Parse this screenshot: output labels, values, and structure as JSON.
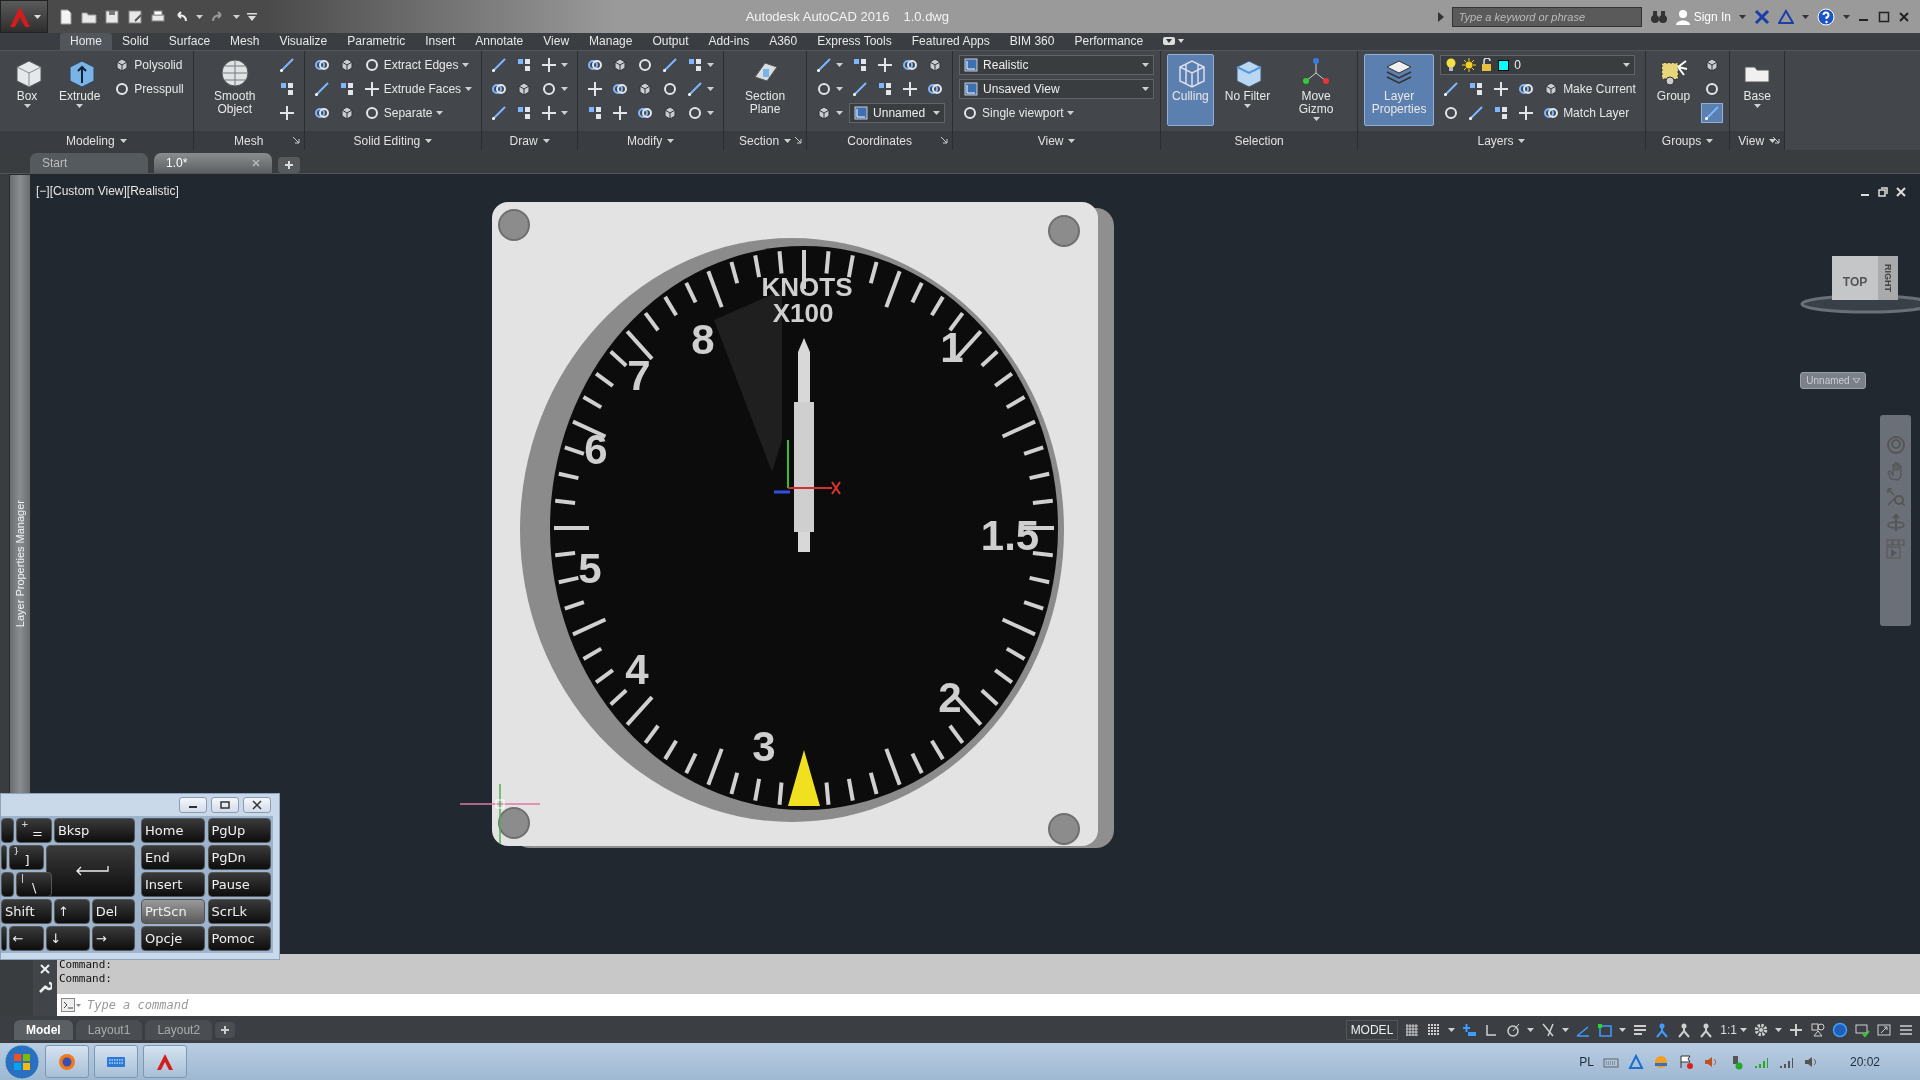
{
  "title_bar": {
    "title": "Autodesk AutoCAD 2016",
    "file": "1.0.dwg",
    "search": {
      "placeholder": "Type a keyword or phrase"
    },
    "sign_in": "Sign In"
  },
  "ribbon_tabs": [
    {
      "label": "Home",
      "selected": true
    },
    {
      "label": "Solid",
      "selected": false
    },
    {
      "label": "Surface",
      "selected": false
    },
    {
      "label": "Mesh",
      "selected": false
    },
    {
      "label": "Visualize",
      "selected": false
    },
    {
      "label": "Parametric",
      "selected": false
    },
    {
      "label": "Insert",
      "selected": false
    },
    {
      "label": "Annotate",
      "selected": false
    },
    {
      "label": "View",
      "selected": false
    },
    {
      "label": "Manage",
      "selected": false
    },
    {
      "label": "Output",
      "selected": false
    },
    {
      "label": "Add-ins",
      "selected": false
    },
    {
      "label": "A360",
      "selected": false
    },
    {
      "label": "Express Tools",
      "selected": false
    },
    {
      "label": "Featured Apps",
      "selected": false
    },
    {
      "label": "BIM 360",
      "selected": false
    },
    {
      "label": "Performance",
      "selected": false
    }
  ],
  "ribbon_panels": [
    {
      "title": "Modeling",
      "menu": true,
      "blocks": [
        {
          "kind": "large",
          "label": "Box",
          "dropdown": true,
          "on": false
        },
        {
          "kind": "large",
          "label": "Extrude",
          "dropdown": true,
          "on": false
        },
        {
          "kind": "stack",
          "rows": [
            [
              {
                "kind": "tool",
                "label": "Polysolid",
                "on": false
              }
            ],
            [
              {
                "kind": "tool",
                "label": "Presspull",
                "on": false
              }
            ]
          ]
        }
      ]
    },
    {
      "title": "Mesh",
      "launcher": true,
      "blocks": [
        {
          "kind": "large",
          "label": "Smooth Object",
          "on": false
        },
        {
          "kind": "stack",
          "rows": [
            [
              {
                "kind": "tool",
                "on": false
              }
            ],
            [
              {
                "kind": "tool",
                "on": false
              }
            ],
            [
              {
                "kind": "tool",
                "on": false
              }
            ]
          ]
        }
      ]
    },
    {
      "title": "Solid Editing",
      "menu": true,
      "blocks": [
        {
          "kind": "stack",
          "rows": [
            [
              {
                "kind": "tool",
                "on": false
              },
              {
                "kind": "tool",
                "on": false
              },
              {
                "kind": "tool",
                "label": "Extract Edges",
                "dropdown": true,
                "on": false
              }
            ],
            [
              {
                "kind": "tool",
                "on": false
              },
              {
                "kind": "tool",
                "on": false
              },
              {
                "kind": "tool",
                "label": "Extrude Faces",
                "dropdown": true,
                "on": false
              }
            ],
            [
              {
                "kind": "tool",
                "on": false
              },
              {
                "kind": "tool",
                "on": false
              },
              {
                "kind": "tool",
                "label": "Separate",
                "dropdown": true,
                "on": false
              }
            ]
          ]
        }
      ]
    },
    {
      "title": "Draw",
      "menu": true,
      "blocks": [
        {
          "kind": "stack",
          "rows": [
            [
              {
                "kind": "tool",
                "on": false
              },
              {
                "kind": "tool",
                "on": false
              },
              {
                "kind": "tool",
                "dropdown": true,
                "on": false
              }
            ],
            [
              {
                "kind": "tool",
                "on": false
              },
              {
                "kind": "tool",
                "on": false
              },
              {
                "kind": "tool",
                "dropdown": true,
                "on": false
              }
            ],
            [
              {
                "kind": "tool",
                "on": false
              },
              {
                "kind": "tool",
                "on": false
              },
              {
                "kind": "tool",
                "dropdown": true,
                "on": false
              }
            ]
          ]
        }
      ]
    },
    {
      "title": "Modify",
      "menu": true,
      "blocks": [
        {
          "kind": "stack",
          "rows": [
            [
              {
                "kind": "tool",
                "on": false
              },
              {
                "kind": "tool",
                "on": false
              },
              {
                "kind": "tool",
                "on": false
              },
              {
                "kind": "tool",
                "on": false
              },
              {
                "kind": "tool",
                "dropdown": true,
                "on": false
              }
            ],
            [
              {
                "kind": "tool",
                "on": false
              },
              {
                "kind": "tool",
                "on": false
              },
              {
                "kind": "tool",
                "on": false
              },
              {
                "kind": "tool",
                "on": false
              },
              {
                "kind": "tool",
                "dropdown": true,
                "on": false
              }
            ],
            [
              {
                "kind": "tool",
                "on": false
              },
              {
                "kind": "tool",
                "on": false
              },
              {
                "kind": "tool",
                "on": false
              },
              {
                "kind": "tool",
                "on": false
              },
              {
                "kind": "tool",
                "dropdown": true,
                "on": false
              }
            ]
          ]
        }
      ]
    },
    {
      "title": "Section",
      "menu": true,
      "launcher": true,
      "blocks": [
        {
          "kind": "large",
          "label": "Section Plane",
          "on": false
        }
      ]
    },
    {
      "title": "Coordinates",
      "launcher": true,
      "blocks": [
        {
          "kind": "stack",
          "rows": [
            [
              {
                "kind": "tool",
                "dropdown": true,
                "on": false
              },
              {
                "kind": "tool",
                "on": false
              },
              {
                "kind": "tool",
                "on": false
              },
              {
                "kind": "tool",
                "on": false
              },
              {
                "kind": "tool",
                "on": false
              }
            ],
            [
              {
                "kind": "tool",
                "dropdown": true,
                "on": false
              },
              {
                "kind": "tool",
                "on": false
              },
              {
                "kind": "tool",
                "on": false
              },
              {
                "kind": "tool",
                "on": false
              },
              {
                "kind": "tool",
                "on": false
              }
            ],
            [
              {
                "kind": "tool",
                "dropdown": true,
                "on": false
              },
              {
                "kind": "combo",
                "value": "Unnamed"
              }
            ]
          ]
        }
      ]
    },
    {
      "title": "View",
      "menu": true,
      "blocks": [
        {
          "kind": "stack",
          "rows": [
            [
              {
                "kind": "combo",
                "value": "Realistic"
              }
            ],
            [
              {
                "kind": "combo",
                "value": "Unsaved View"
              }
            ],
            [
              {
                "kind": "tool",
                "label": "Single viewport",
                "dropdown": true,
                "on": false
              }
            ]
          ]
        }
      ]
    },
    {
      "title": "Selection",
      "blocks": [
        {
          "kind": "large",
          "label": "Culling",
          "on": true
        },
        {
          "kind": "large",
          "label": "No Filter",
          "dropdown": true,
          "on": false
        },
        {
          "kind": "large",
          "label": "Move Gizmo",
          "dropdown": true,
          "on": false
        }
      ]
    },
    {
      "title": "Layers",
      "menu": true,
      "blocks": [
        {
          "kind": "large",
          "label": "Layer Properties",
          "on": true
        },
        {
          "kind": "stack",
          "rows": [
            [
              {
                "kind": "layer",
                "value": "0",
                "color": "#00ffff"
              }
            ],
            [
              {
                "kind": "tool",
                "on": false
              },
              {
                "kind": "tool",
                "on": false
              },
              {
                "kind": "tool",
                "on": false
              },
              {
                "kind": "tool",
                "on": false
              },
              {
                "kind": "tool",
                "label": "Make Current",
                "on": false
              }
            ],
            [
              {
                "kind": "tool",
                "on": false
              },
              {
                "kind": "tool",
                "on": false
              },
              {
                "kind": "tool",
                "on": false
              },
              {
                "kind": "tool",
                "on": false
              },
              {
                "kind": "tool",
                "label": "Match Layer",
                "on": false
              }
            ]
          ]
        }
      ]
    },
    {
      "title": "Groups",
      "menu": true,
      "blocks": [
        {
          "kind": "large",
          "label": "Group",
          "on": false
        },
        {
          "kind": "stack",
          "rows": [
            [
              {
                "kind": "tool",
                "on": false
              }
            ],
            [
              {
                "kind": "tool",
                "on": false
              }
            ],
            [
              {
                "kind": "tool",
                "on": true
              }
            ]
          ]
        }
      ]
    },
    {
      "title": "View",
      "menu": true,
      "launcher": true,
      "blocks": [
        {
          "kind": "large",
          "label": "Base",
          "dropdown": true,
          "on": false
        }
      ]
    }
  ],
  "doc_tabs": [
    {
      "label": "Start",
      "selected": false
    },
    {
      "label": "1.0*",
      "selected": true,
      "closable": true
    }
  ],
  "palette": {
    "title": "Layer Properties Manager"
  },
  "viewport": {
    "controls": [
      "[−]",
      "[Custom View]",
      "[Realistic]"
    ],
    "gauge": {
      "title": "KNOTS",
      "subtitle": "X100",
      "numbers": [
        "8",
        "7",
        "6",
        "5",
        "4",
        "3",
        "2",
        "1.5",
        "1"
      ]
    },
    "viewcube": {
      "face": "TOP",
      "side": "RIGHT"
    },
    "ucs_menu": "Unnamed"
  },
  "keyboard": {
    "keys": [
      {
        "kind": "stub"
      },
      {
        "kind": "sym",
        "top": "+",
        "label": "="
      },
      {
        "kind": "key",
        "label": "Bksp"
      },
      {
        "kind": "stub"
      },
      {
        "kind": "sym",
        "top": "}",
        "label": "]"
      },
      {
        "kind": "enter"
      },
      {
        "kind": "stub"
      },
      {
        "kind": "sym",
        "top": "|",
        "label": "\\"
      },
      {
        "kind": "key",
        "label": "Shift"
      },
      {
        "kind": "key",
        "label": "↑"
      },
      {
        "kind": "key",
        "label": "Del"
      },
      {
        "kind": "stub"
      },
      {
        "kind": "key",
        "label": "←"
      },
      {
        "kind": "key",
        "label": "↓"
      },
      {
        "kind": "key",
        "label": "→"
      }
    ],
    "nav_keys": [
      {
        "label": "Home",
        "on": false
      },
      {
        "label": "PgUp",
        "on": false
      },
      {
        "label": "End",
        "on": false
      },
      {
        "label": "PgDn",
        "on": false
      },
      {
        "label": "Insert",
        "on": false
      },
      {
        "label": "Pause",
        "on": false
      },
      {
        "label": "PrtScn",
        "on": true
      },
      {
        "label": "ScrLk",
        "on": false
      },
      {
        "label": "Opcje",
        "on": false
      },
      {
        "label": "Pomoc",
        "on": false
      }
    ]
  },
  "command": {
    "history": [
      "Command:",
      "Command:"
    ],
    "input": {
      "placeholder": "Type a command"
    }
  },
  "layout_tabs": [
    {
      "label": "Model",
      "selected": true
    },
    {
      "label": "Layout1",
      "selected": false
    },
    {
      "label": "Layout2",
      "selected": false
    }
  ],
  "status_bar": {
    "model": "MODEL",
    "toggles": [
      {
        "kind": "grid",
        "on": false
      },
      {
        "kind": "snap",
        "on": false,
        "dropdown": true
      },
      {
        "kind": "infer",
        "on": true
      },
      {
        "kind": "ortho",
        "on": false
      },
      {
        "kind": "polar",
        "on": false,
        "dropdown": true
      },
      {
        "kind": "iso",
        "on": false,
        "dropdown": true
      },
      {
        "kind": "track",
        "on": true
      },
      {
        "kind": "osnap",
        "on": true,
        "dropdown": true
      },
      {
        "kind": "lineweight",
        "on": false
      },
      {
        "kind": "figure",
        "on": true
      },
      {
        "kind": "figure",
        "on": false
      },
      {
        "kind": "figure",
        "on": false
      }
    ],
    "scale": "1:1",
    "tools": [
      {
        "kind": "gear",
        "on": false,
        "dropdown": true
      },
      {
        "kind": "plus",
        "on": false
      },
      {
        "kind": "shapes",
        "on": false
      },
      {
        "kind": "ring",
        "on": true
      },
      {
        "kind": "monitor",
        "on": false
      },
      {
        "kind": "fullscreen",
        "on": false
      },
      {
        "kind": "menu",
        "on": false
      }
    ]
  },
  "taskbar": {
    "language": "PL",
    "clock": "20:02"
  }
}
